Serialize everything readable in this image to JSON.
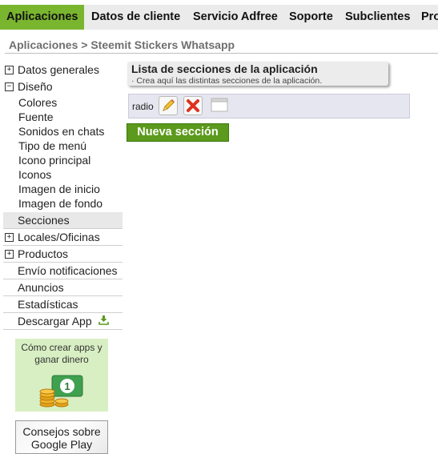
{
  "topnav": {
    "tabs": [
      {
        "label": "Aplicaciones",
        "active": true
      },
      {
        "label": "Datos de cliente"
      },
      {
        "label": "Servicio Adfree"
      },
      {
        "label": "Soporte"
      },
      {
        "label": "Subclientes"
      },
      {
        "label": "Pro"
      }
    ]
  },
  "breadcrumb": "Aplicaciones > Steemit Stickers Whatsapp",
  "sidebar": {
    "datos_generales": "Datos generales",
    "diseno": "Diseño",
    "diseno_sub": [
      "Colores",
      "Fuente",
      "Sonidos en chats",
      "Tipo de menú",
      "Icono principal",
      "Iconos",
      "Imagen de inicio",
      "Imagen de fondo"
    ],
    "secciones": "Secciones",
    "locales": "Locales/Oficinas",
    "productos": "Productos",
    "envio": "Envío notificaciones",
    "anuncios": "Anuncios",
    "estadisticas": "Estadísticas",
    "descargar": "Descargar App",
    "expand_plus": "+",
    "expand_minus": "−"
  },
  "ads": {
    "crear_apps": "Cómo crear apps y ganar dinero",
    "consejos": "Consejos sobre Google Play"
  },
  "main": {
    "title": "Lista de secciones de la aplicación",
    "description": "· Crea aquí las distintas secciones de la aplicación.",
    "section_name": "radio",
    "new_button": "Nueva sección"
  },
  "colors": {
    "accent": "#7ab52f",
    "button": "#5b9a1c"
  }
}
